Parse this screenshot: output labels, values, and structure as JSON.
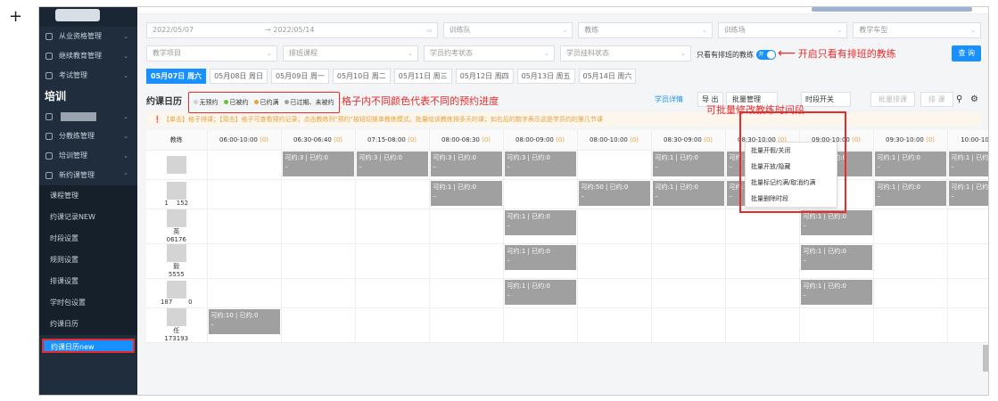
{
  "sidebar": {
    "items": [
      {
        "label": "从业资格管理",
        "icon": "id-icon"
      },
      {
        "label": "继续教育管理",
        "icon": "book-icon"
      },
      {
        "label": "考试管理",
        "icon": "exam-icon"
      }
    ],
    "section": "培训",
    "items2": [
      {
        "label": "分教练管理",
        "icon": "user-icon"
      },
      {
        "label": "培训管理",
        "icon": "list-icon"
      },
      {
        "label": "新约课管理",
        "icon": "calendar-icon"
      }
    ],
    "subs": [
      "课程管理",
      "约课记录NEW",
      "时段设置",
      "规则设置",
      "排课设置",
      "学时包设置",
      "约课日历"
    ],
    "active": "约课日历new"
  },
  "filters": {
    "date_start": "2022/05/07",
    "date_end": "2022/05/14",
    "team": "训练队",
    "coach": "教练",
    "field": "训练场",
    "car": "教学车型",
    "project": "教学项目",
    "course": "排班课程",
    "status": "学员约考状态",
    "subject": "学员挂科状态",
    "only_label": "只看有排班的教练",
    "toggle": "开",
    "query": "查 询"
  },
  "annotations": {
    "toggle_note": "开启只看有排班的教练",
    "legend_note": "格子内不同颜色代表不同的预约进度",
    "batch_note": "可批量修改教练时间段"
  },
  "tabs": [
    "05月07日 周六",
    "05月08日 周日",
    "05月09日 周一",
    "05月10日 周二",
    "05月11日 周三",
    "05月12日 周四",
    "05月13日 周五",
    "05月14日 周六"
  ],
  "calendar": {
    "title": "约课日历",
    "legend": [
      "无预约",
      "已被约",
      "已约满",
      "已过期、未被约"
    ],
    "legend_colors": [
      "#cfcfcf",
      "#67c23a",
      "#e6a23c",
      "#a0a0a0"
    ],
    "detail": "学员详情",
    "export": "导 出",
    "batch": "批量管理",
    "slot_switch": "时段开关",
    "batch_sched": "批量排课",
    "sched": "排 课"
  },
  "notice": "【单击】格子排课；【双击】格子可查看预约记录；点击教练列\"预约\"按钮切换单教练模式。批量给该教练排多天的课；如右后的数字表示这是学员约的第几节课",
  "dropdown": [
    "批量开假/关闭",
    "批量开放/隐藏",
    "批量标记约满/取消约满",
    "批量删除时段"
  ],
  "table": {
    "headers": [
      "教练",
      "06:00-10:00",
      "06:30-06:40",
      "07:15-08:00",
      "08:00-08:30",
      "08:00-09:00",
      "08:00-10:00",
      "08:30-09:00",
      "08:30-10:00",
      "09:00-10:00",
      "09:30-10:00",
      "10:00-10"
    ],
    "zero": "(0)",
    "rows": [
      {
        "name": "",
        "cells": [
          0,
          [
            3,
            0
          ],
          [
            3,
            0
          ],
          [
            3,
            0
          ],
          [
            3,
            0
          ],
          0,
          [
            1,
            0
          ],
          [
            1,
            0
          ],
          [
            3,
            0
          ],
          [
            1,
            0
          ],
          [
            1,
            0
          ]
        ]
      },
      {
        "name": "1    152",
        "cells": [
          0,
          0,
          0,
          [
            1,
            0
          ],
          0,
          [
            50,
            0
          ],
          [
            1,
            0
          ],
          [
            1,
            0
          ],
          0,
          [
            1,
            0
          ],
          [
            1,
            0
          ]
        ]
      },
      {
        "name": "英\n06176",
        "cells": [
          0,
          0,
          0,
          0,
          [
            1,
            0
          ],
          0,
          0,
          0,
          [
            1,
            0
          ],
          0,
          0
        ]
      },
      {
        "name": "毅\n5555",
        "cells": [
          0,
          0,
          0,
          0,
          [
            1,
            0
          ],
          0,
          0,
          0,
          [
            1,
            0
          ],
          0,
          0
        ]
      },
      {
        "name": "187        0",
        "cells": [
          0,
          0,
          0,
          0,
          [
            1,
            0
          ],
          0,
          0,
          0,
          [
            1,
            0
          ],
          0,
          0
        ]
      },
      {
        "name": "任\n173193",
        "cells": [
          [
            10,
            0
          ],
          0,
          0,
          0,
          0,
          0,
          0,
          0,
          0,
          0,
          0
        ]
      }
    ]
  },
  "cell_labels": {
    "avail": "可约:",
    "booked": "已约:"
  }
}
